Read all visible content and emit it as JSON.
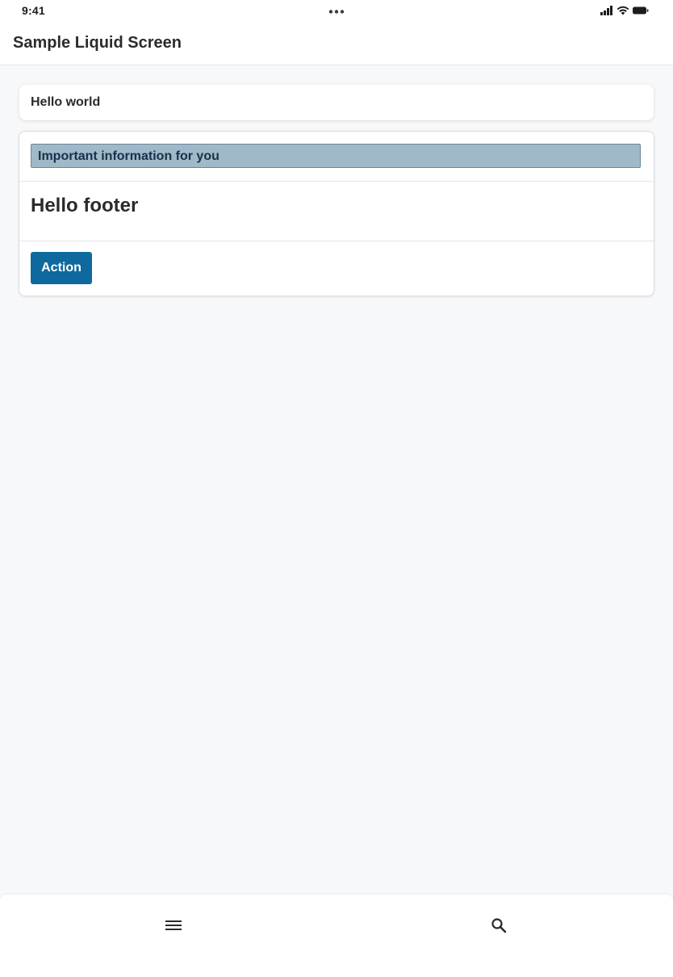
{
  "status_bar": {
    "time": "9:41",
    "dots_icon": "more-dots-icon",
    "signal_icon": "cellular-signal-icon",
    "wifi_icon": "wifi-icon",
    "battery_icon": "battery-icon"
  },
  "header": {
    "title": "Sample Liquid Screen"
  },
  "main": {
    "simple_card": {
      "text": "Hello world"
    },
    "info_card": {
      "banner_text": "Important information for you",
      "banner_color": "#a1b8c8",
      "footer_heading": "Hello footer",
      "action_label": "Action",
      "action_color": "#0e6a9e"
    }
  },
  "bottom_nav": {
    "menu_icon": "hamburger-menu-icon",
    "search_icon": "search-icon"
  }
}
